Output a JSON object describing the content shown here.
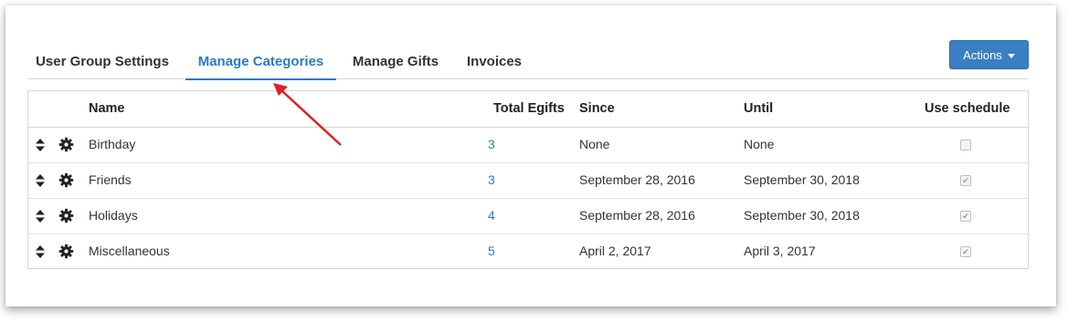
{
  "tabs": [
    {
      "label": "User Group Settings",
      "active": false
    },
    {
      "label": "Manage Categories",
      "active": true
    },
    {
      "label": "Manage Gifts",
      "active": false
    },
    {
      "label": "Invoices",
      "active": false
    }
  ],
  "actions_button": {
    "label": "Actions"
  },
  "table": {
    "headers": {
      "name": "Name",
      "total_egifts": "Total Egifts",
      "since": "Since",
      "until": "Until",
      "use_schedule": "Use schedule"
    },
    "rows": [
      {
        "name": "Birthday",
        "total_egifts": "3",
        "since": "None",
        "until": "None",
        "use_schedule": false
      },
      {
        "name": "Friends",
        "total_egifts": "3",
        "since": "September 28, 2016",
        "until": "September 30, 2018",
        "use_schedule": true
      },
      {
        "name": "Holidays",
        "total_egifts": "4",
        "since": "September 28, 2016",
        "until": "September 30, 2018",
        "use_schedule": true
      },
      {
        "name": "Miscellaneous",
        "total_egifts": "5",
        "since": "April 2, 2017",
        "until": "April 3, 2017",
        "use_schedule": true
      }
    ]
  },
  "colors": {
    "accent": "#2a7bc2",
    "annotation_arrow": "#e02020",
    "button_bg": "#3a7fc1"
  },
  "icons": {
    "drag": "sort-handle-icon",
    "settings": "gear-icon",
    "dropdown": "caret-down-icon"
  }
}
